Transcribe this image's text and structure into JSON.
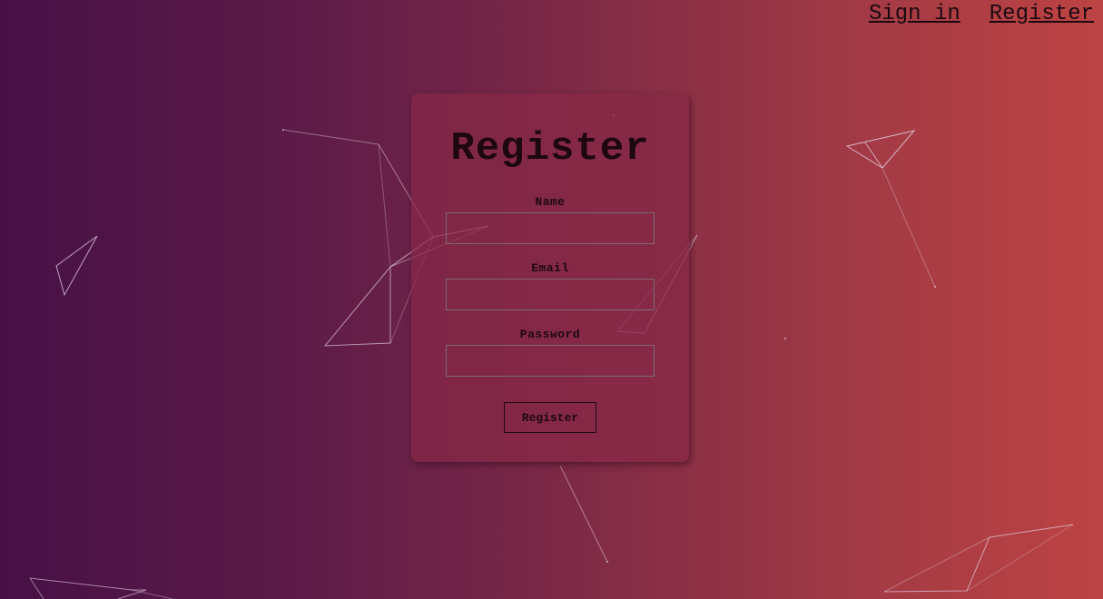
{
  "nav": {
    "sign_in": "Sign in",
    "register": "Register"
  },
  "form": {
    "title": "Register",
    "name_label": "Name",
    "name_value": "",
    "email_label": "Email",
    "email_value": "",
    "password_label": "Password",
    "password_value": "",
    "submit_label": "Register"
  },
  "colors": {
    "gradient_start": "#461046",
    "gradient_end": "#bd4343",
    "text": "#1e0810"
  }
}
